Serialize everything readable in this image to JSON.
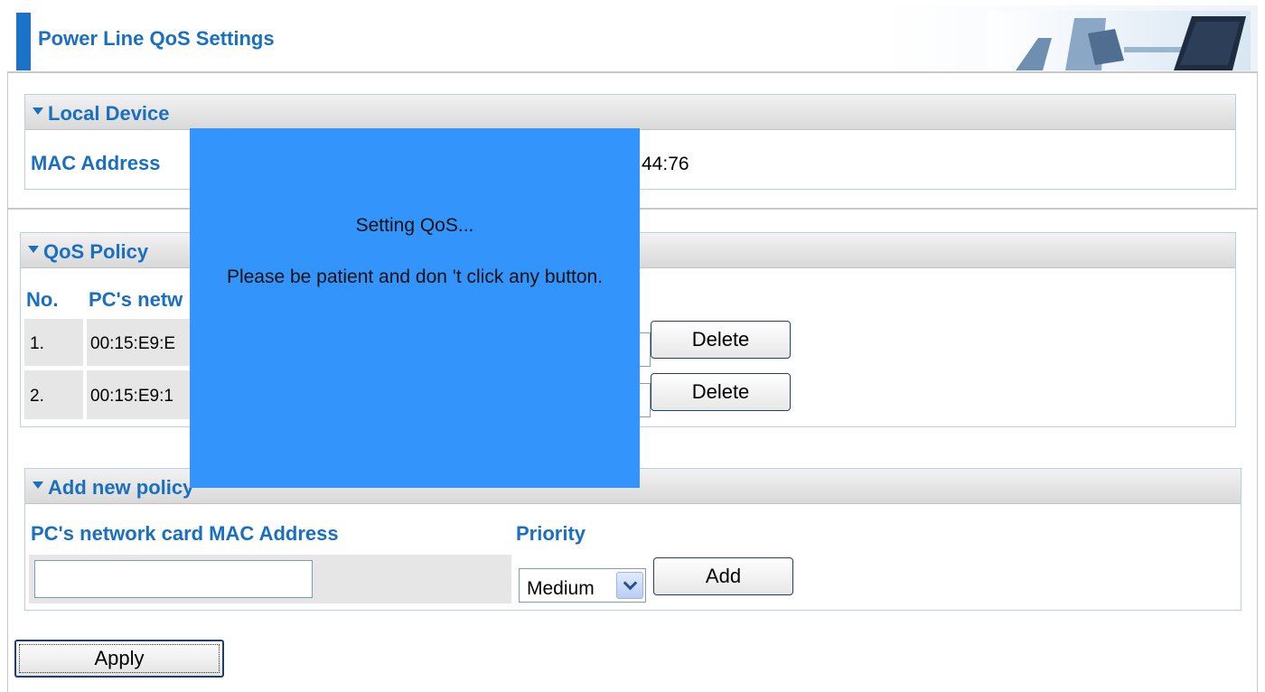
{
  "header": {
    "title": "Power Line QoS Settings"
  },
  "local_device": {
    "section_title": "Local Device",
    "mac_label": "MAC Address",
    "mac_value_visible": "44:76"
  },
  "qos_policy": {
    "section_title": "QoS Policy",
    "col_no": "No.",
    "col_mac_visible": "PC's netw",
    "rows": [
      {
        "no": "1.",
        "mac_visible": "00:15:E9:E",
        "delete_label": "Delete"
      },
      {
        "no": "2.",
        "mac_visible": "00:15:E9:1",
        "delete_label": "Delete"
      }
    ]
  },
  "add_policy": {
    "section_title": "Add new policy",
    "mac_label": "PC's network card MAC Address",
    "priority_label": "Priority",
    "mac_input_value": "",
    "priority_selected": "Medium",
    "add_label": "Add"
  },
  "overlay": {
    "line1": "Setting QoS...",
    "line2": "Please be patient and don 't click any button."
  },
  "apply_label": "Apply",
  "colors": {
    "accent_blue": "#1a6fc0",
    "overlay_blue": "#3394fb",
    "panel_border": "#b9cfe6"
  }
}
